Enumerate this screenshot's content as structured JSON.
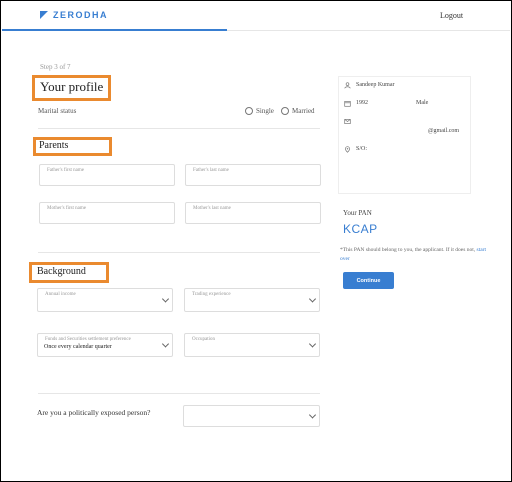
{
  "header": {
    "brand": "ZERODHA",
    "logout": "Logout"
  },
  "steps": "Step 3 of 7",
  "profile": {
    "title": "Your profile",
    "marital_label": "Marital status",
    "options": [
      "Single",
      "Married"
    ]
  },
  "parents": {
    "title": "Parents",
    "fields": [
      "Father's first name",
      "Father's last name",
      "Mother's first name",
      "Mother's last name"
    ]
  },
  "background": {
    "title": "Background",
    "annual_income": "Annual income",
    "trading_experience": "Trading experience",
    "settlement_label": "Funds and Securities settlement preference",
    "settlement_value": "Once every calendar quarter",
    "occupation": "Occupation"
  },
  "pep": {
    "question": "Are you a politically exposed person?"
  },
  "summary": {
    "name": "Sandeep Kumar",
    "dob": "1992",
    "gender": "Male",
    "email": "@gmail.com",
    "address": "S/O:"
  },
  "pan": {
    "label": "Your PAN",
    "value": "KCAP",
    "note": "*This PAN should belong to you, the applicant. If it does not,",
    "link": "start over",
    "button": "Continue"
  },
  "colors": {
    "brand": "#387ed1",
    "highlight": "#ea8a2f"
  }
}
